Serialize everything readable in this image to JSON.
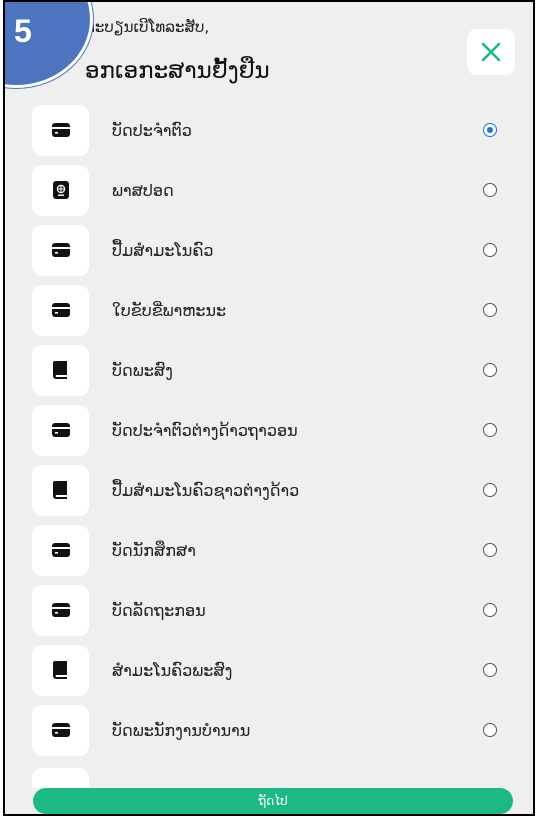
{
  "step_badge": "5",
  "header": {
    "subtitle": "ທະບຽນເບີໂທລະສັບ,",
    "title": "ອກເອກະສານຢັ້ງຢືນ"
  },
  "icons": {
    "close": "close-icon",
    "card": "id-card-icon",
    "passport": "passport-icon",
    "book": "book-icon"
  },
  "colors": {
    "accent": "#1db983",
    "radio_selected": "#1a73e8",
    "badge": "#4d74bf"
  },
  "documents": [
    {
      "label": "ບັດປະຈຳຕົວ",
      "icon": "card",
      "selected": true
    },
    {
      "label": "ພາສປອດ",
      "icon": "passport",
      "selected": false
    },
    {
      "label": "ປື້ມສຳມະໂນຄົວ",
      "icon": "card",
      "selected": false
    },
    {
      "label": "ໃບຂັບຂີ່ພາຫະນະ",
      "icon": "card",
      "selected": false
    },
    {
      "label": "ບັດພະສົງ",
      "icon": "book",
      "selected": false
    },
    {
      "label": "ບັດປະຈຳຕົວຕ່າງດ້າວຖາວອນ",
      "icon": "card",
      "selected": false
    },
    {
      "label": "ປື້ມສຳມະໂນຄົວຊາວຕ່າງດ້າວ",
      "icon": "book",
      "selected": false
    },
    {
      "label": "ບັດນັກສຶກສາ",
      "icon": "card",
      "selected": false
    },
    {
      "label": "ບັດລັດຖະກອນ",
      "icon": "card",
      "selected": false
    },
    {
      "label": "ສຳມະໂນຄົວພະສົງ",
      "icon": "book",
      "selected": false
    },
    {
      "label": "ບັດພະນັກງານບຳນານ",
      "icon": "card",
      "selected": false
    }
  ],
  "footer": {
    "next_label": "ຖັດໄປ"
  }
}
